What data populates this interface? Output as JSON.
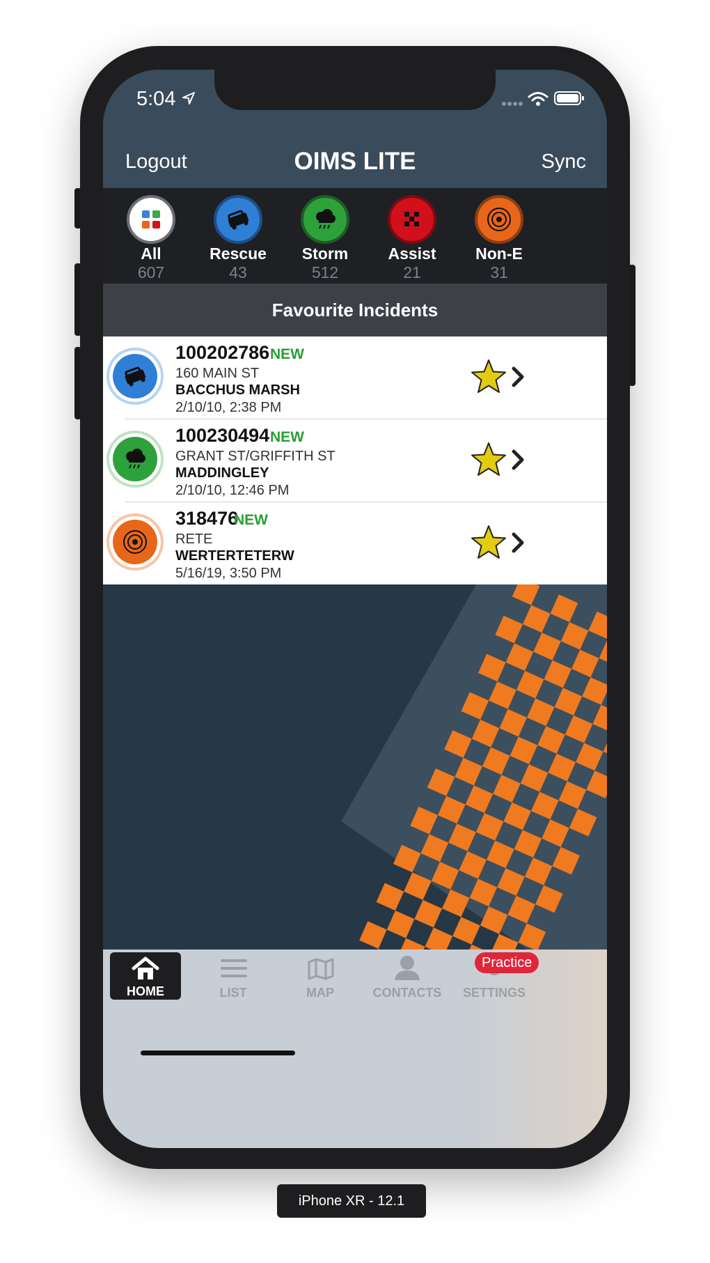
{
  "status_bar": {
    "time": "5:04"
  },
  "nav": {
    "logout": "Logout",
    "title": "OIMS LITE",
    "sync": "Sync"
  },
  "filters": [
    {
      "label": "All",
      "count": "607",
      "color": "#ffffff"
    },
    {
      "label": "Rescue",
      "count": "43",
      "color": "#2f7fd7"
    },
    {
      "label": "Storm",
      "count": "512",
      "color": "#2ea23a"
    },
    {
      "label": "Assist",
      "count": "21",
      "color": "#d2101c"
    },
    {
      "label": "Non-E",
      "count": "31",
      "color": "#e8661a"
    }
  ],
  "favourites": {
    "header": "Favourite Incidents",
    "rows": [
      {
        "id": "100202786",
        "badge": "NEW",
        "address": "160 MAIN ST",
        "suburb": "BACCHUS MARSH",
        "date": "2/10/10, 2:38 PM",
        "type": "rescue"
      },
      {
        "id": "100230494",
        "badge": "NEW",
        "address": "GRANT ST/GRIFFITH ST",
        "suburb": "MADDINGLEY",
        "date": "2/10/10, 12:46 PM",
        "type": "storm"
      },
      {
        "id": "318476",
        "badge": "NEW",
        "address": "RETE",
        "suburb": "WERTERTETERW",
        "date": "5/16/19, 3:50 PM",
        "type": "non-emergency"
      }
    ]
  },
  "tabs": [
    {
      "label": "HOME",
      "active": true
    },
    {
      "label": "LIST"
    },
    {
      "label": "MAP"
    },
    {
      "label": "CONTACTS"
    },
    {
      "label": "SETTINGS"
    }
  ],
  "settings_badge": "Practice",
  "device_label": "iPhone XR - 12.1",
  "colors": {
    "navbar": "#3a4b5b",
    "new_badge": "#2a9d33",
    "star": "#e2cc10",
    "pattern": "#f07a1f",
    "background": "#263746"
  }
}
